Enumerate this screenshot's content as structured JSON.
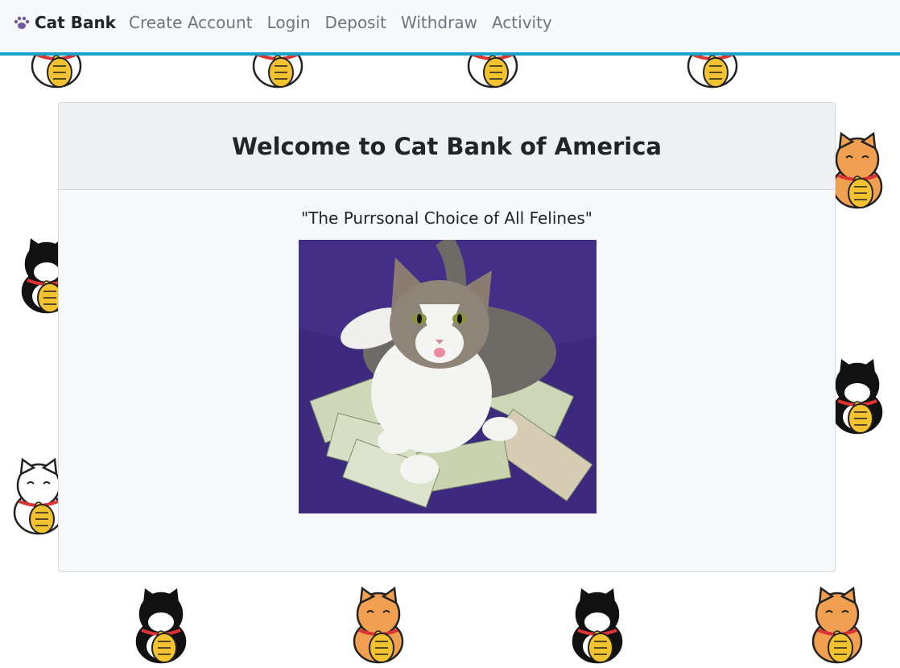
{
  "navbar": {
    "brand_label": "Cat Bank",
    "brand_icon": "paw-icon",
    "links": [
      {
        "label": "Create Account"
      },
      {
        "label": "Login"
      },
      {
        "label": "Deposit"
      },
      {
        "label": "Withdraw"
      },
      {
        "label": "Activity"
      }
    ],
    "accent_color": "#17a2c8"
  },
  "card": {
    "title": "Welcome to Cat Bank of America",
    "tagline": "\"The Purrsonal Choice of All Felines\"",
    "image_icon": "cat-on-money-photo"
  },
  "background": {
    "pattern_icon": "lucky-cat-icon"
  }
}
